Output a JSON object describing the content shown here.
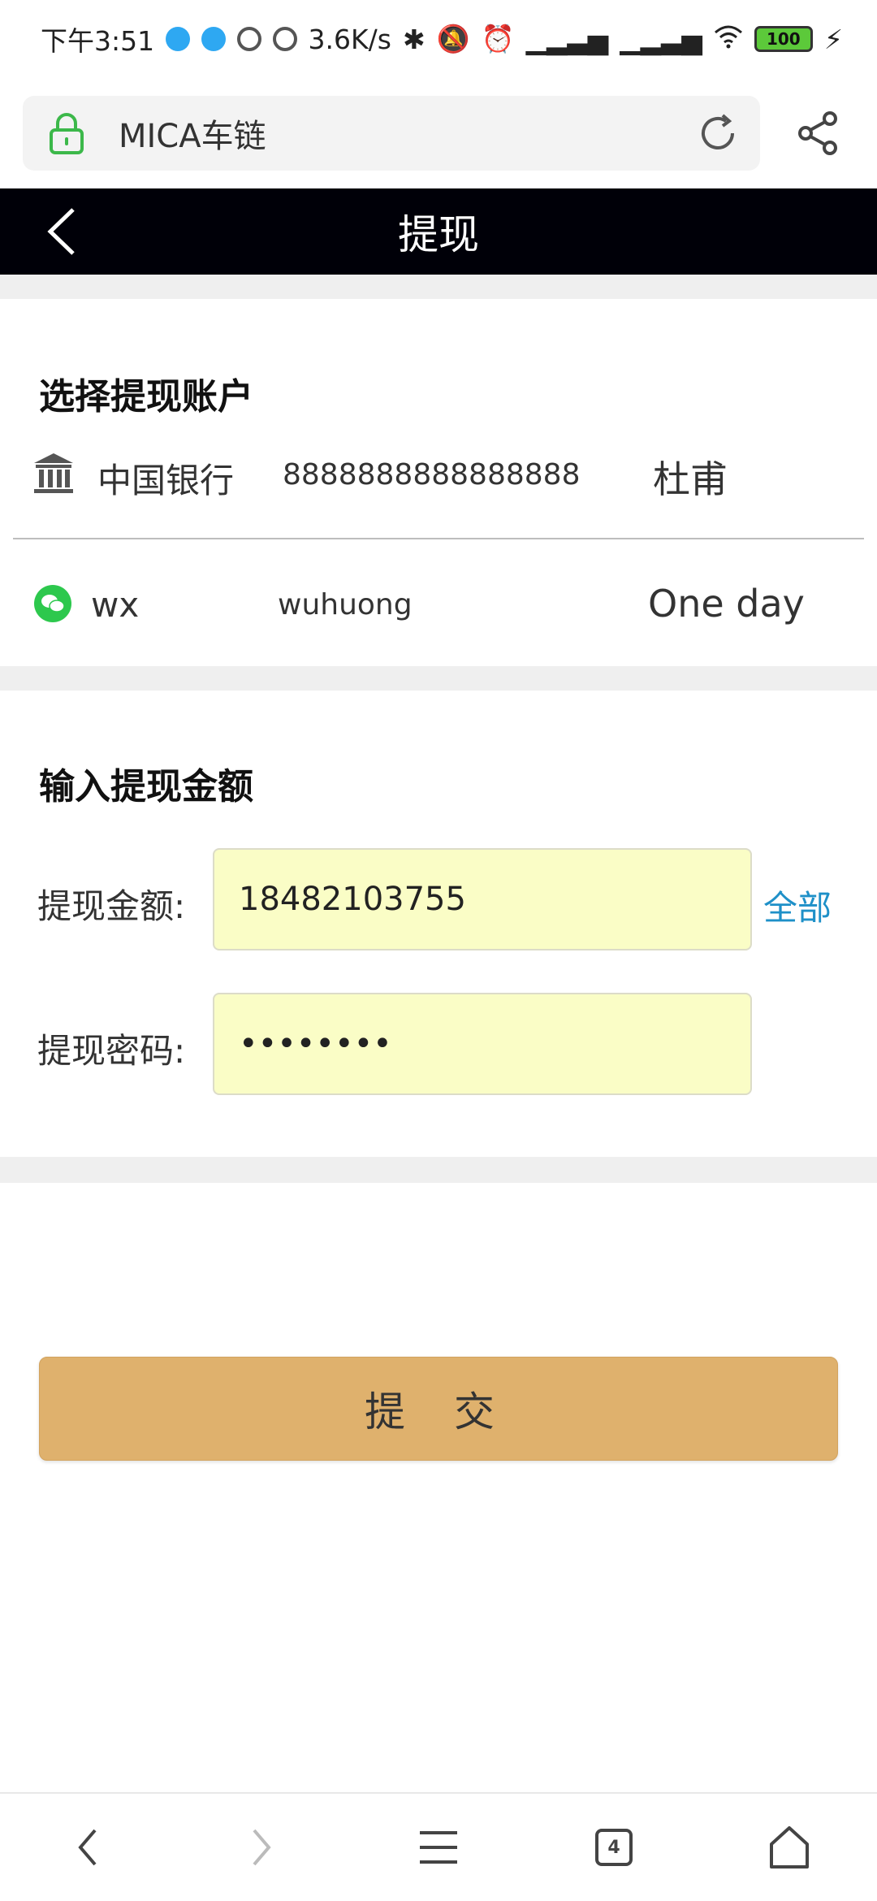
{
  "status_bar": {
    "time": "下午3:51",
    "network_speed": "3.6K/s",
    "battery": "100"
  },
  "browser": {
    "url_title": "MICA车链"
  },
  "nav": {
    "title": "提现"
  },
  "accounts_section": {
    "title": "选择提现账户",
    "accounts": [
      {
        "type": "bank",
        "icon": "bank-icon",
        "name": "中国银行",
        "number": "8888888888888888",
        "holder": "杜甫"
      },
      {
        "type": "wechat",
        "icon": "wechat-icon",
        "name": "wx",
        "number": "wuhuong",
        "holder": "One day"
      }
    ]
  },
  "amount_section": {
    "title": "输入提现金额",
    "amount_label": "提现金额:",
    "amount_value": "18482103755",
    "all_label": "全部",
    "password_label": "提现密码:",
    "password_value": "••••••••"
  },
  "submit_label": "提 交",
  "bottom_nav": {
    "tab_count": "4"
  },
  "colors": {
    "nav_bg": "#000008",
    "input_bg": "#fafdc6",
    "submit_bg": "#dfb16d",
    "link": "#1e90c8",
    "wechat_green": "#2dc84d"
  }
}
